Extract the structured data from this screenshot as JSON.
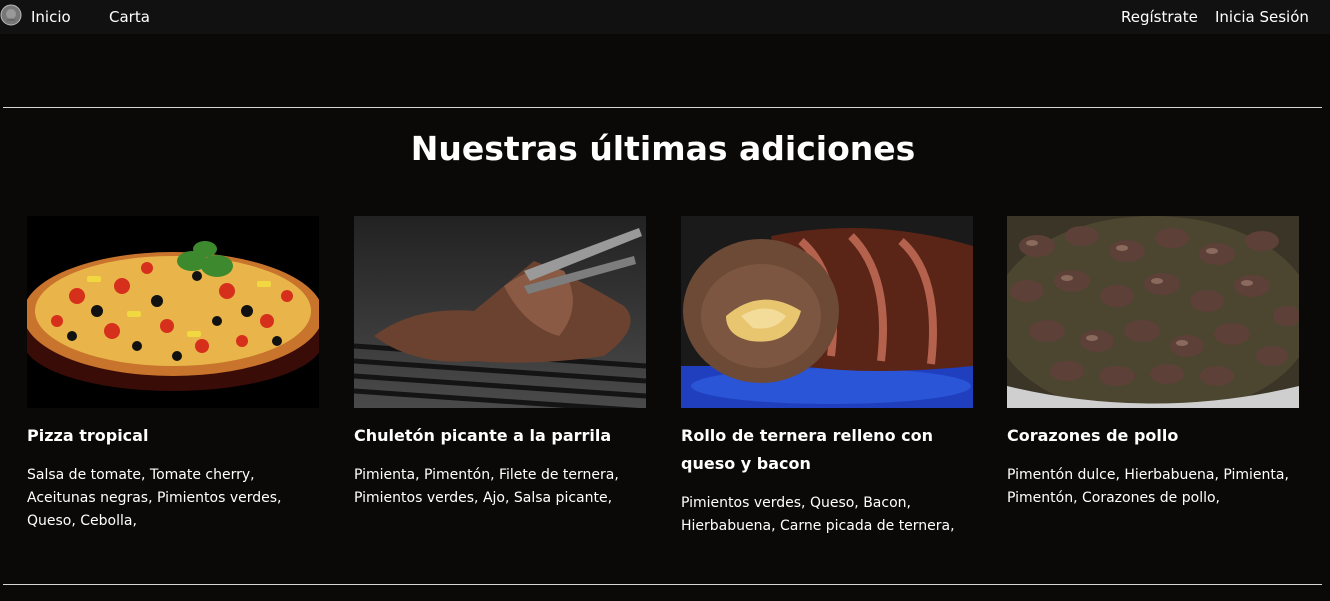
{
  "nav": {
    "left": [
      "Inicio",
      "Carta"
    ],
    "right": [
      "Regístrate",
      "Inicia Sesión"
    ]
  },
  "section": {
    "title": "Nuestras últimas adiciones"
  },
  "cards": [
    {
      "title": "Pizza tropical",
      "ingredients": "Salsa de tomate, Tomate cherry, Aceitunas negras, Pimientos verdes, Queso, Cebolla,"
    },
    {
      "title": "Chuletón picante a la parrila",
      "ingredients": "Pimienta, Pimentón, Filete de ternera, Pimientos verdes, Ajo, Salsa picante,"
    },
    {
      "title": "Rollo de ternera relleno con queso y bacon",
      "ingredients": "Pimientos verdes, Queso, Bacon, Hierbabuena, Carne picada de ternera,"
    },
    {
      "title": "Corazones de pollo",
      "ingredients": "Pimentón dulce, Hierbabuena, Pimienta, Pimentón, Corazones de pollo,"
    }
  ]
}
